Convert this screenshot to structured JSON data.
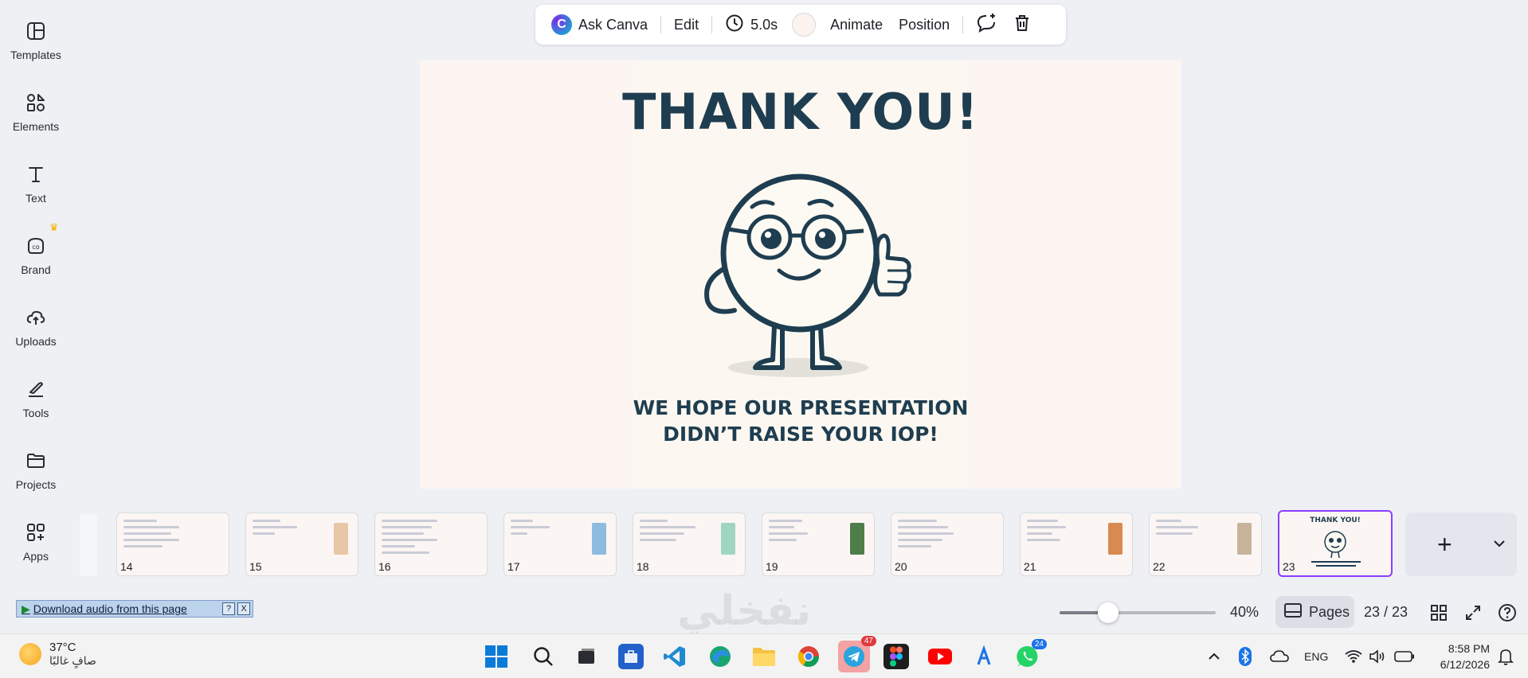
{
  "sidebar": {
    "items": [
      {
        "label": "Templates",
        "icon": "templates-icon"
      },
      {
        "label": "Elements",
        "icon": "elements-icon"
      },
      {
        "label": "Text",
        "icon": "text-icon"
      },
      {
        "label": "Brand",
        "icon": "brand-icon"
      },
      {
        "label": "Uploads",
        "icon": "uploads-icon"
      },
      {
        "label": "Tools",
        "icon": "tools-icon"
      },
      {
        "label": "Projects",
        "icon": "projects-icon"
      },
      {
        "label": "Apps",
        "icon": "apps-icon"
      }
    ]
  },
  "toolbar": {
    "ask_canva": "Ask Canva",
    "edit": "Edit",
    "duration": "5.0s",
    "animate": "Animate",
    "position": "Position"
  },
  "slide": {
    "title": "THANK YOU!",
    "subtitle_line1": "WE HOPE OUR PRESENTATION",
    "subtitle_line2": "DIDN’T RAISE YOUR IOP!"
  },
  "filmstrip": {
    "pages": [
      "14",
      "15",
      "16",
      "17",
      "18",
      "19",
      "20",
      "21",
      "22",
      "23"
    ],
    "active_page": "23",
    "active_mini_title": "THANK YOU!"
  },
  "bottom_bar": {
    "download_audio": "Download audio from this page",
    "help_mini": "?",
    "close_mini": "X",
    "zoom": "40%",
    "zoom_level": 0.4,
    "pages_label": "Pages",
    "page_count": "23 / 23",
    "watermark": "نفخلي"
  },
  "taskbar": {
    "temperature": "37°C",
    "weather_desc": "صافٍ غالبًا",
    "telegram_badge": "47",
    "whatsapp_badge": "24",
    "language": "ENG",
    "time": "8:58 PM",
    "date": "6/12/2026"
  },
  "colors": {
    "accent": "#8b3dff",
    "slide_text": "#1f3d50",
    "slide_bg": "#fdf5f2"
  }
}
